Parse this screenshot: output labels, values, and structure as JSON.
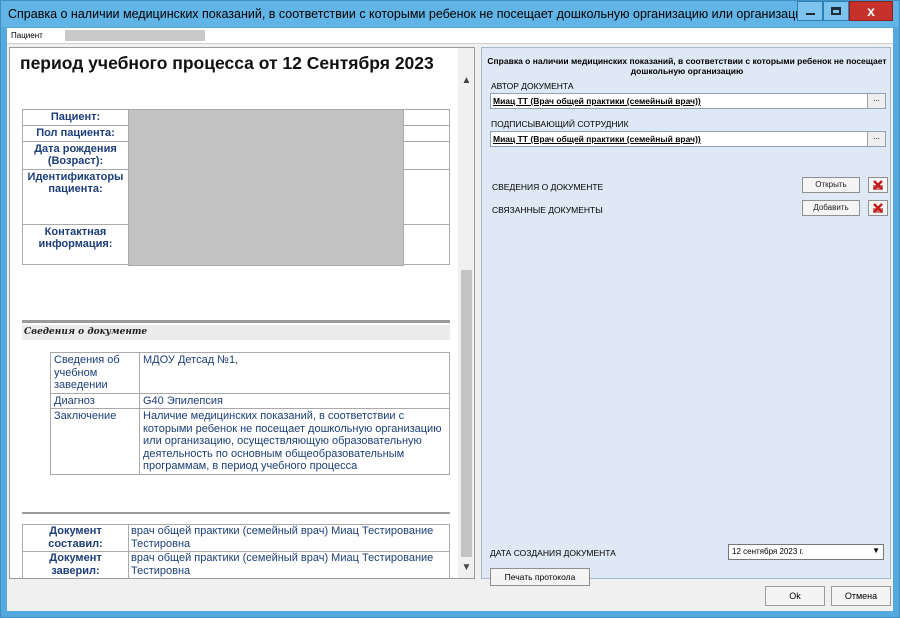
{
  "window": {
    "title": "Справка о наличии медицинских показаний, в соответствии с которыми ребенок не посещает дошкольную организацию или организацию, ...",
    "min_label": "",
    "max_label": "",
    "close_label": "x"
  },
  "patient_strip": {
    "label": "Пациент"
  },
  "document": {
    "heading": "период учебного процесса от 12 Сентября 2023",
    "patient_table": {
      "patient": "Пациент:",
      "gender": "Пол пациента:",
      "birth": "Дата рождения (Возраст):",
      "identifiers": "Идентификаторы пациента:",
      "contact": "Контактная информация:"
    },
    "section_title": "Сведения о документе",
    "info_table": {
      "rows": [
        {
          "label": "Сведения об учебном заведении",
          "value": "МДОУ Детсад №1,"
        },
        {
          "label": "Диагноз",
          "value": "G40 Эпилепсия"
        },
        {
          "label": "Заключение",
          "value": "Наличие медицинских показаний, в соответствии с которыми ребенок не посещает дошкольную организацию или организацию, осуществляющую образовательную деятельность по основным общеобразовательным программам, в период учебного процесса"
        }
      ]
    },
    "footer_table": {
      "rows": [
        {
          "label": "Документ составил:",
          "value": "врач общей практики (семейный врач) Миац Тестирование Тестировна"
        },
        {
          "label": "Документ заверил:",
          "value": "врач общей практики (семейный врач) Миац Тестирование Тестировна"
        }
      ]
    }
  },
  "side": {
    "title": "Справка о наличии медицинских показаний, в соответствии с которыми ребенок не посещает дошкольную организацию",
    "author_label": "АВТОР ДОКУМЕНТА",
    "author_value": "Миац ТТ (Врач общей практики (семейный врач))",
    "signer_label": "ПОДПИСЫВАЮЩИЙ СОТРУДНИК",
    "signer_value": "Миац ТТ (Врач общей практики (семейный врач))",
    "browse_label": "...",
    "doc_info_label": "СВЕДЕНИЯ О ДОКУМЕНТЕ",
    "open_label": "Открыть",
    "related_label": "СВЯЗАННЫЕ ДОКУМЕНТЫ",
    "add_label": "Добавить",
    "date_label": "ДАТА СОЗДАНИЯ ДОКУМЕНТА",
    "date_value": "12 сентября 2023 г.",
    "print_label": "Печать протокола"
  },
  "buttons": {
    "ok": "Ok",
    "cancel": "Отмена"
  },
  "colors": {
    "title_bar": "#61b4e6",
    "doc_text": "#1c3e79",
    "side_bg": "#dfe9f5",
    "close": "#c7312b"
  }
}
